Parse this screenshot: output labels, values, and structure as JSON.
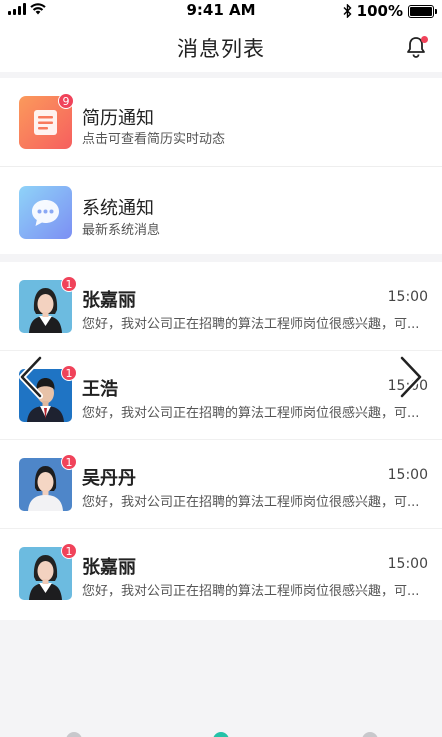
{
  "status_bar": {
    "time": "9:41 AM",
    "battery": "100%"
  },
  "header": {
    "title": "消息列表"
  },
  "notices": [
    {
      "title": "简历通知",
      "subtitle": "点击可查看简历实时动态",
      "badge": "9",
      "icon": "resume-icon"
    },
    {
      "title": "系统通知",
      "subtitle": "最新系统消息",
      "icon": "chat-bubble-icon"
    }
  ],
  "messages": [
    {
      "name": "张嘉丽",
      "time": "15:00",
      "preview": "您好，我对公司正在招聘的算法工程师岗位很感兴趣，可...",
      "badge": "1"
    },
    {
      "name": "王浩",
      "time": "15:00",
      "preview": "您好，我对公司正在招聘的算法工程师岗位很感兴趣，可...",
      "badge": "1"
    },
    {
      "name": "吴丹丹",
      "time": "15:00",
      "preview": "您好，我对公司正在招聘的算法工程师岗位很感兴趣，可...",
      "badge": "1"
    },
    {
      "name": "张嘉丽",
      "time": "15:00",
      "preview": "您好，我对公司正在招聘的算法工程师岗位很感兴趣，可...",
      "badge": "1"
    }
  ],
  "colors": {
    "badge": "#f0435a",
    "resume_icon": "#f96a5a",
    "system_icon": "#7fa6f5",
    "tab_active": "#25c2a8"
  }
}
